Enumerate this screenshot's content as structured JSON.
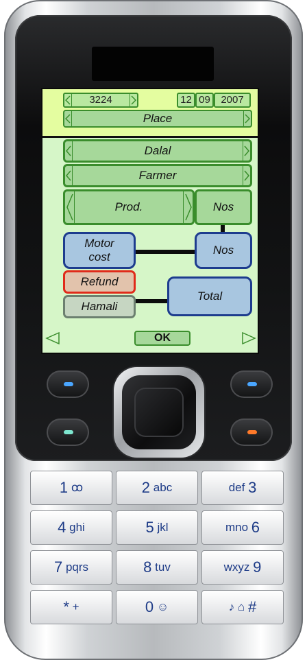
{
  "header": {
    "record_number": "3224",
    "date": {
      "day": "12",
      "month": "09",
      "year": "2007"
    },
    "place_label": "Place"
  },
  "form": {
    "dalal_label": "Dalal",
    "farmer_label": "Farmer",
    "product_label": "Prod.",
    "product_qty_label": "Nos",
    "motor_cost_label": "Motor cost",
    "motor_qty_label": "Nos",
    "refund_label": "Refund",
    "hamali_label": "Hamali",
    "total_label": "Total"
  },
  "footer": {
    "ok_label": "OK"
  },
  "keypad": {
    "keys": [
      [
        "1",
        "ꝏ"
      ],
      [
        "2",
        "abc"
      ],
      [
        "def",
        "3"
      ],
      [
        "4",
        "ghi"
      ],
      [
        "5",
        "jkl"
      ],
      [
        "mno",
        "6"
      ],
      [
        "7",
        "pqrs"
      ],
      [
        "8",
        "tuv"
      ],
      [
        "wxyz",
        "9"
      ],
      [
        "*",
        "+"
      ],
      [
        "0",
        "☺"
      ],
      [
        "♪ ⌂",
        "#"
      ]
    ]
  },
  "colors": {
    "screen_bg": "#d6f6c8",
    "header_bg": "#e4fda0",
    "green_field": "#a6d89a",
    "blue_field": "#a8c6e0",
    "refund_border": "#e02a1a",
    "softkey_blue": "#4aa6ff",
    "softkey_green": "#7ee6cf",
    "softkey_orange": "#ff7a2a"
  }
}
